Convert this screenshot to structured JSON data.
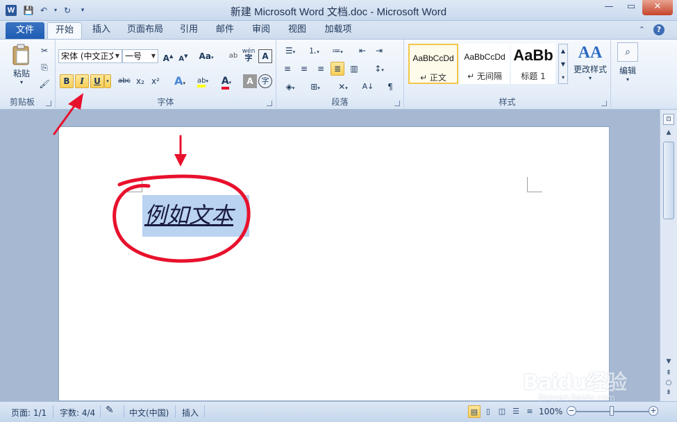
{
  "window": {
    "title": "新建 Microsoft Word 文档.doc - Microsoft Word",
    "app_icon": "W"
  },
  "ribbon_tabs": {
    "file": "文件",
    "tabs": [
      "开始",
      "插入",
      "页面布局",
      "引用",
      "邮件",
      "审阅",
      "视图",
      "加载项"
    ],
    "active": "开始"
  },
  "clipboard": {
    "paste_label": "粘贴",
    "group_label": "剪贴板"
  },
  "font": {
    "font_name": "宋体 (中文正文",
    "font_size": "一号",
    "group_label": "字体",
    "bold": "B",
    "italic": "I",
    "underline": "U",
    "grow": "A",
    "shrink": "A",
    "case": "Aa",
    "strike": "abc",
    "sub": "x₂",
    "sup": "x²",
    "text_effect": "A",
    "highlight": "ab",
    "font_color": "A",
    "char_shade": "A",
    "enclose": "字",
    "phonetic": "wén",
    "border_char": "A"
  },
  "paragraph": {
    "group_label": "段落"
  },
  "styles": {
    "group_label": "样式",
    "items": [
      {
        "sample": "AaBbCcDd",
        "name": "↵ 正文"
      },
      {
        "sample": "AaBbCcDd",
        "name": "↵ 无间隔"
      },
      {
        "sample": "AaBb",
        "name": "标题 1"
      }
    ],
    "change_label": "更改样式"
  },
  "editing": {
    "label": "编辑"
  },
  "document": {
    "selected_text": "例如文本"
  },
  "status": {
    "page": "页面: 1/1",
    "words": "字数: 4/4",
    "language": "中文(中国)",
    "insert_mode": "插入",
    "zoom": "100%",
    "zoom_level": 1.0
  },
  "watermark": {
    "logo": "Baidu经验",
    "url": "jingyan.baidu.com"
  },
  "colors": {
    "selection": "#b9d3f0",
    "annotation": "#e8112d",
    "file_tab": "#1e5cb3"
  }
}
